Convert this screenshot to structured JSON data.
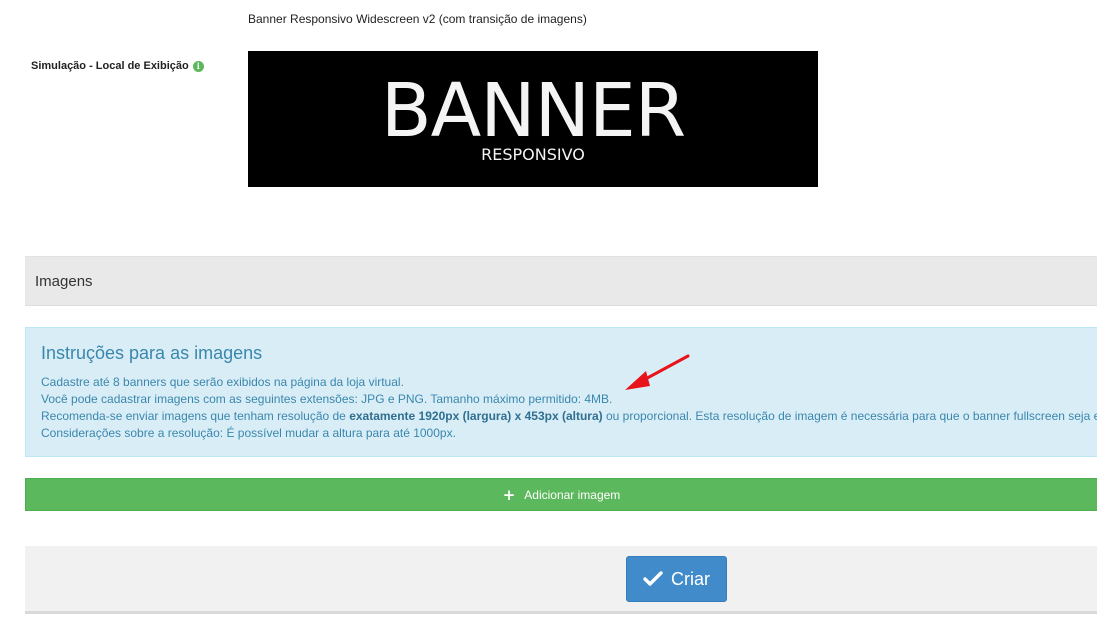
{
  "banner_type": {
    "text": "Banner Responsivo Widescreen v2 (com transição de imagens)"
  },
  "simulation": {
    "label": "Simulação - Local de Exibição",
    "info_icon": "info-icon",
    "preview_big_text": "BANNER",
    "preview_small_text": "RESPONSIVO"
  },
  "images_section": {
    "title": "Imagens"
  },
  "instructions": {
    "title": "Instruções para as imagens",
    "line1": "Cadastre até 8 banners que serão exibidos na página da loja virtual.",
    "line2": "Você pode cadastrar imagens com as seguintes extensões: JPG e PNG. Tamanho máximo permitido: 4MB.",
    "line3_pre": "Recomenda-se enviar imagens que tenham resolução de ",
    "line3_bold": "exatamente 1920px (largura) x 453px (altura)",
    "line3_post": " ou proporcional. Esta resolução de imagem é necessária para que o banner fullscreen seja e",
    "line4": "Considerações sobre a resolução: É possível mudar a altura para até 1000px."
  },
  "actions": {
    "add_image_label": "Adicionar imagem",
    "add_icon": "plus-icon",
    "create_label": "Criar",
    "create_icon": "check-icon"
  },
  "colors": {
    "success_green": "#5cb85c",
    "primary_blue": "#428bca",
    "info_bg": "#d9edf7",
    "info_text": "#3a87ad",
    "arrow_red": "#e8141b"
  }
}
